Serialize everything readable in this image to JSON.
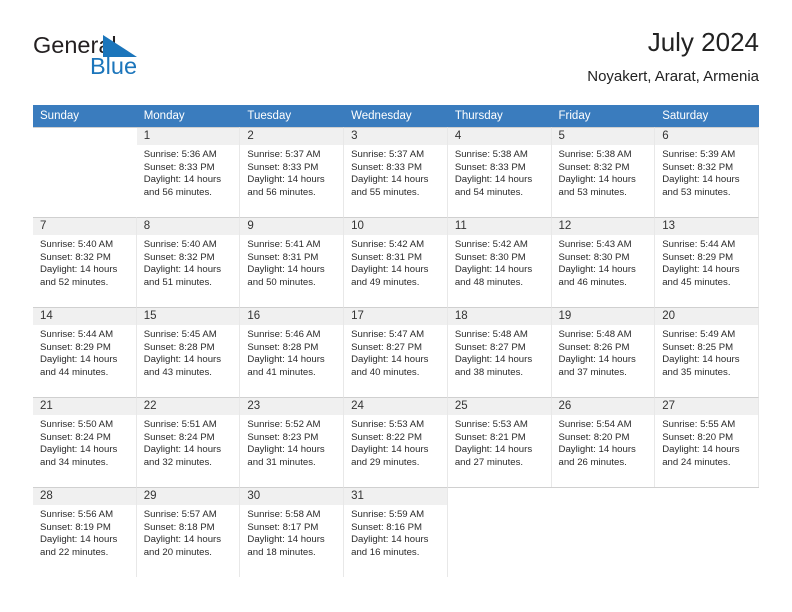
{
  "brand": {
    "name_part1": "General",
    "name_part2": "Blue",
    "triangle_color": "#1b75bb",
    "text_color": "#231f20"
  },
  "header": {
    "title": "July 2024",
    "subtitle": "Noyakert, Ararat, Armenia"
  },
  "theme": {
    "header_row_bg": "#3a7cbe",
    "header_row_text": "#ffffff",
    "daynum_band_bg": "#f0f0f0",
    "cell_text": "#2a2a2a"
  },
  "weekdays": [
    "Sunday",
    "Monday",
    "Tuesday",
    "Wednesday",
    "Thursday",
    "Friday",
    "Saturday"
  ],
  "weeks": [
    [
      {
        "day": "",
        "sunrise": "",
        "sunset": "",
        "daylight_line1": "",
        "daylight_line2": ""
      },
      {
        "day": "1",
        "sunrise": "Sunrise: 5:36 AM",
        "sunset": "Sunset: 8:33 PM",
        "daylight_line1": "Daylight: 14 hours",
        "daylight_line2": "and 56 minutes."
      },
      {
        "day": "2",
        "sunrise": "Sunrise: 5:37 AM",
        "sunset": "Sunset: 8:33 PM",
        "daylight_line1": "Daylight: 14 hours",
        "daylight_line2": "and 56 minutes."
      },
      {
        "day": "3",
        "sunrise": "Sunrise: 5:37 AM",
        "sunset": "Sunset: 8:33 PM",
        "daylight_line1": "Daylight: 14 hours",
        "daylight_line2": "and 55 minutes."
      },
      {
        "day": "4",
        "sunrise": "Sunrise: 5:38 AM",
        "sunset": "Sunset: 8:33 PM",
        "daylight_line1": "Daylight: 14 hours",
        "daylight_line2": "and 54 minutes."
      },
      {
        "day": "5",
        "sunrise": "Sunrise: 5:38 AM",
        "sunset": "Sunset: 8:32 PM",
        "daylight_line1": "Daylight: 14 hours",
        "daylight_line2": "and 53 minutes."
      },
      {
        "day": "6",
        "sunrise": "Sunrise: 5:39 AM",
        "sunset": "Sunset: 8:32 PM",
        "daylight_line1": "Daylight: 14 hours",
        "daylight_line2": "and 53 minutes."
      }
    ],
    [
      {
        "day": "7",
        "sunrise": "Sunrise: 5:40 AM",
        "sunset": "Sunset: 8:32 PM",
        "daylight_line1": "Daylight: 14 hours",
        "daylight_line2": "and 52 minutes."
      },
      {
        "day": "8",
        "sunrise": "Sunrise: 5:40 AM",
        "sunset": "Sunset: 8:32 PM",
        "daylight_line1": "Daylight: 14 hours",
        "daylight_line2": "and 51 minutes."
      },
      {
        "day": "9",
        "sunrise": "Sunrise: 5:41 AM",
        "sunset": "Sunset: 8:31 PM",
        "daylight_line1": "Daylight: 14 hours",
        "daylight_line2": "and 50 minutes."
      },
      {
        "day": "10",
        "sunrise": "Sunrise: 5:42 AM",
        "sunset": "Sunset: 8:31 PM",
        "daylight_line1": "Daylight: 14 hours",
        "daylight_line2": "and 49 minutes."
      },
      {
        "day": "11",
        "sunrise": "Sunrise: 5:42 AM",
        "sunset": "Sunset: 8:30 PM",
        "daylight_line1": "Daylight: 14 hours",
        "daylight_line2": "and 48 minutes."
      },
      {
        "day": "12",
        "sunrise": "Sunrise: 5:43 AM",
        "sunset": "Sunset: 8:30 PM",
        "daylight_line1": "Daylight: 14 hours",
        "daylight_line2": "and 46 minutes."
      },
      {
        "day": "13",
        "sunrise": "Sunrise: 5:44 AM",
        "sunset": "Sunset: 8:29 PM",
        "daylight_line1": "Daylight: 14 hours",
        "daylight_line2": "and 45 minutes."
      }
    ],
    [
      {
        "day": "14",
        "sunrise": "Sunrise: 5:44 AM",
        "sunset": "Sunset: 8:29 PM",
        "daylight_line1": "Daylight: 14 hours",
        "daylight_line2": "and 44 minutes."
      },
      {
        "day": "15",
        "sunrise": "Sunrise: 5:45 AM",
        "sunset": "Sunset: 8:28 PM",
        "daylight_line1": "Daylight: 14 hours",
        "daylight_line2": "and 43 minutes."
      },
      {
        "day": "16",
        "sunrise": "Sunrise: 5:46 AM",
        "sunset": "Sunset: 8:28 PM",
        "daylight_line1": "Daylight: 14 hours",
        "daylight_line2": "and 41 minutes."
      },
      {
        "day": "17",
        "sunrise": "Sunrise: 5:47 AM",
        "sunset": "Sunset: 8:27 PM",
        "daylight_line1": "Daylight: 14 hours",
        "daylight_line2": "and 40 minutes."
      },
      {
        "day": "18",
        "sunrise": "Sunrise: 5:48 AM",
        "sunset": "Sunset: 8:27 PM",
        "daylight_line1": "Daylight: 14 hours",
        "daylight_line2": "and 38 minutes."
      },
      {
        "day": "19",
        "sunrise": "Sunrise: 5:48 AM",
        "sunset": "Sunset: 8:26 PM",
        "daylight_line1": "Daylight: 14 hours",
        "daylight_line2": "and 37 minutes."
      },
      {
        "day": "20",
        "sunrise": "Sunrise: 5:49 AM",
        "sunset": "Sunset: 8:25 PM",
        "daylight_line1": "Daylight: 14 hours",
        "daylight_line2": "and 35 minutes."
      }
    ],
    [
      {
        "day": "21",
        "sunrise": "Sunrise: 5:50 AM",
        "sunset": "Sunset: 8:24 PM",
        "daylight_line1": "Daylight: 14 hours",
        "daylight_line2": "and 34 minutes."
      },
      {
        "day": "22",
        "sunrise": "Sunrise: 5:51 AM",
        "sunset": "Sunset: 8:24 PM",
        "daylight_line1": "Daylight: 14 hours",
        "daylight_line2": "and 32 minutes."
      },
      {
        "day": "23",
        "sunrise": "Sunrise: 5:52 AM",
        "sunset": "Sunset: 8:23 PM",
        "daylight_line1": "Daylight: 14 hours",
        "daylight_line2": "and 31 minutes."
      },
      {
        "day": "24",
        "sunrise": "Sunrise: 5:53 AM",
        "sunset": "Sunset: 8:22 PM",
        "daylight_line1": "Daylight: 14 hours",
        "daylight_line2": "and 29 minutes."
      },
      {
        "day": "25",
        "sunrise": "Sunrise: 5:53 AM",
        "sunset": "Sunset: 8:21 PM",
        "daylight_line1": "Daylight: 14 hours",
        "daylight_line2": "and 27 minutes."
      },
      {
        "day": "26",
        "sunrise": "Sunrise: 5:54 AM",
        "sunset": "Sunset: 8:20 PM",
        "daylight_line1": "Daylight: 14 hours",
        "daylight_line2": "and 26 minutes."
      },
      {
        "day": "27",
        "sunrise": "Sunrise: 5:55 AM",
        "sunset": "Sunset: 8:20 PM",
        "daylight_line1": "Daylight: 14 hours",
        "daylight_line2": "and 24 minutes."
      }
    ],
    [
      {
        "day": "28",
        "sunrise": "Sunrise: 5:56 AM",
        "sunset": "Sunset: 8:19 PM",
        "daylight_line1": "Daylight: 14 hours",
        "daylight_line2": "and 22 minutes."
      },
      {
        "day": "29",
        "sunrise": "Sunrise: 5:57 AM",
        "sunset": "Sunset: 8:18 PM",
        "daylight_line1": "Daylight: 14 hours",
        "daylight_line2": "and 20 minutes."
      },
      {
        "day": "30",
        "sunrise": "Sunrise: 5:58 AM",
        "sunset": "Sunset: 8:17 PM",
        "daylight_line1": "Daylight: 14 hours",
        "daylight_line2": "and 18 minutes."
      },
      {
        "day": "31",
        "sunrise": "Sunrise: 5:59 AM",
        "sunset": "Sunset: 8:16 PM",
        "daylight_line1": "Daylight: 14 hours",
        "daylight_line2": "and 16 minutes."
      },
      {
        "day": "",
        "sunrise": "",
        "sunset": "",
        "daylight_line1": "",
        "daylight_line2": ""
      },
      {
        "day": "",
        "sunrise": "",
        "sunset": "",
        "daylight_line1": "",
        "daylight_line2": ""
      },
      {
        "day": "",
        "sunrise": "",
        "sunset": "",
        "daylight_line1": "",
        "daylight_line2": ""
      }
    ]
  ]
}
